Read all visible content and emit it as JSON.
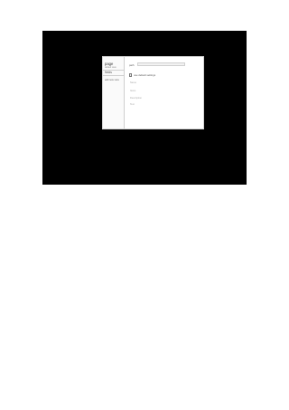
{
  "sidebar": {
    "title": "page",
    "subtitle": "default view",
    "section": "fields",
    "add_link": "add new view"
  },
  "main": {
    "url_label": "path",
    "url_value": "",
    "checkbox_label": "use default settings",
    "checkbox_checked": false,
    "fields": [
      "Name",
      "Items",
      "Description",
      "Text"
    ]
  }
}
